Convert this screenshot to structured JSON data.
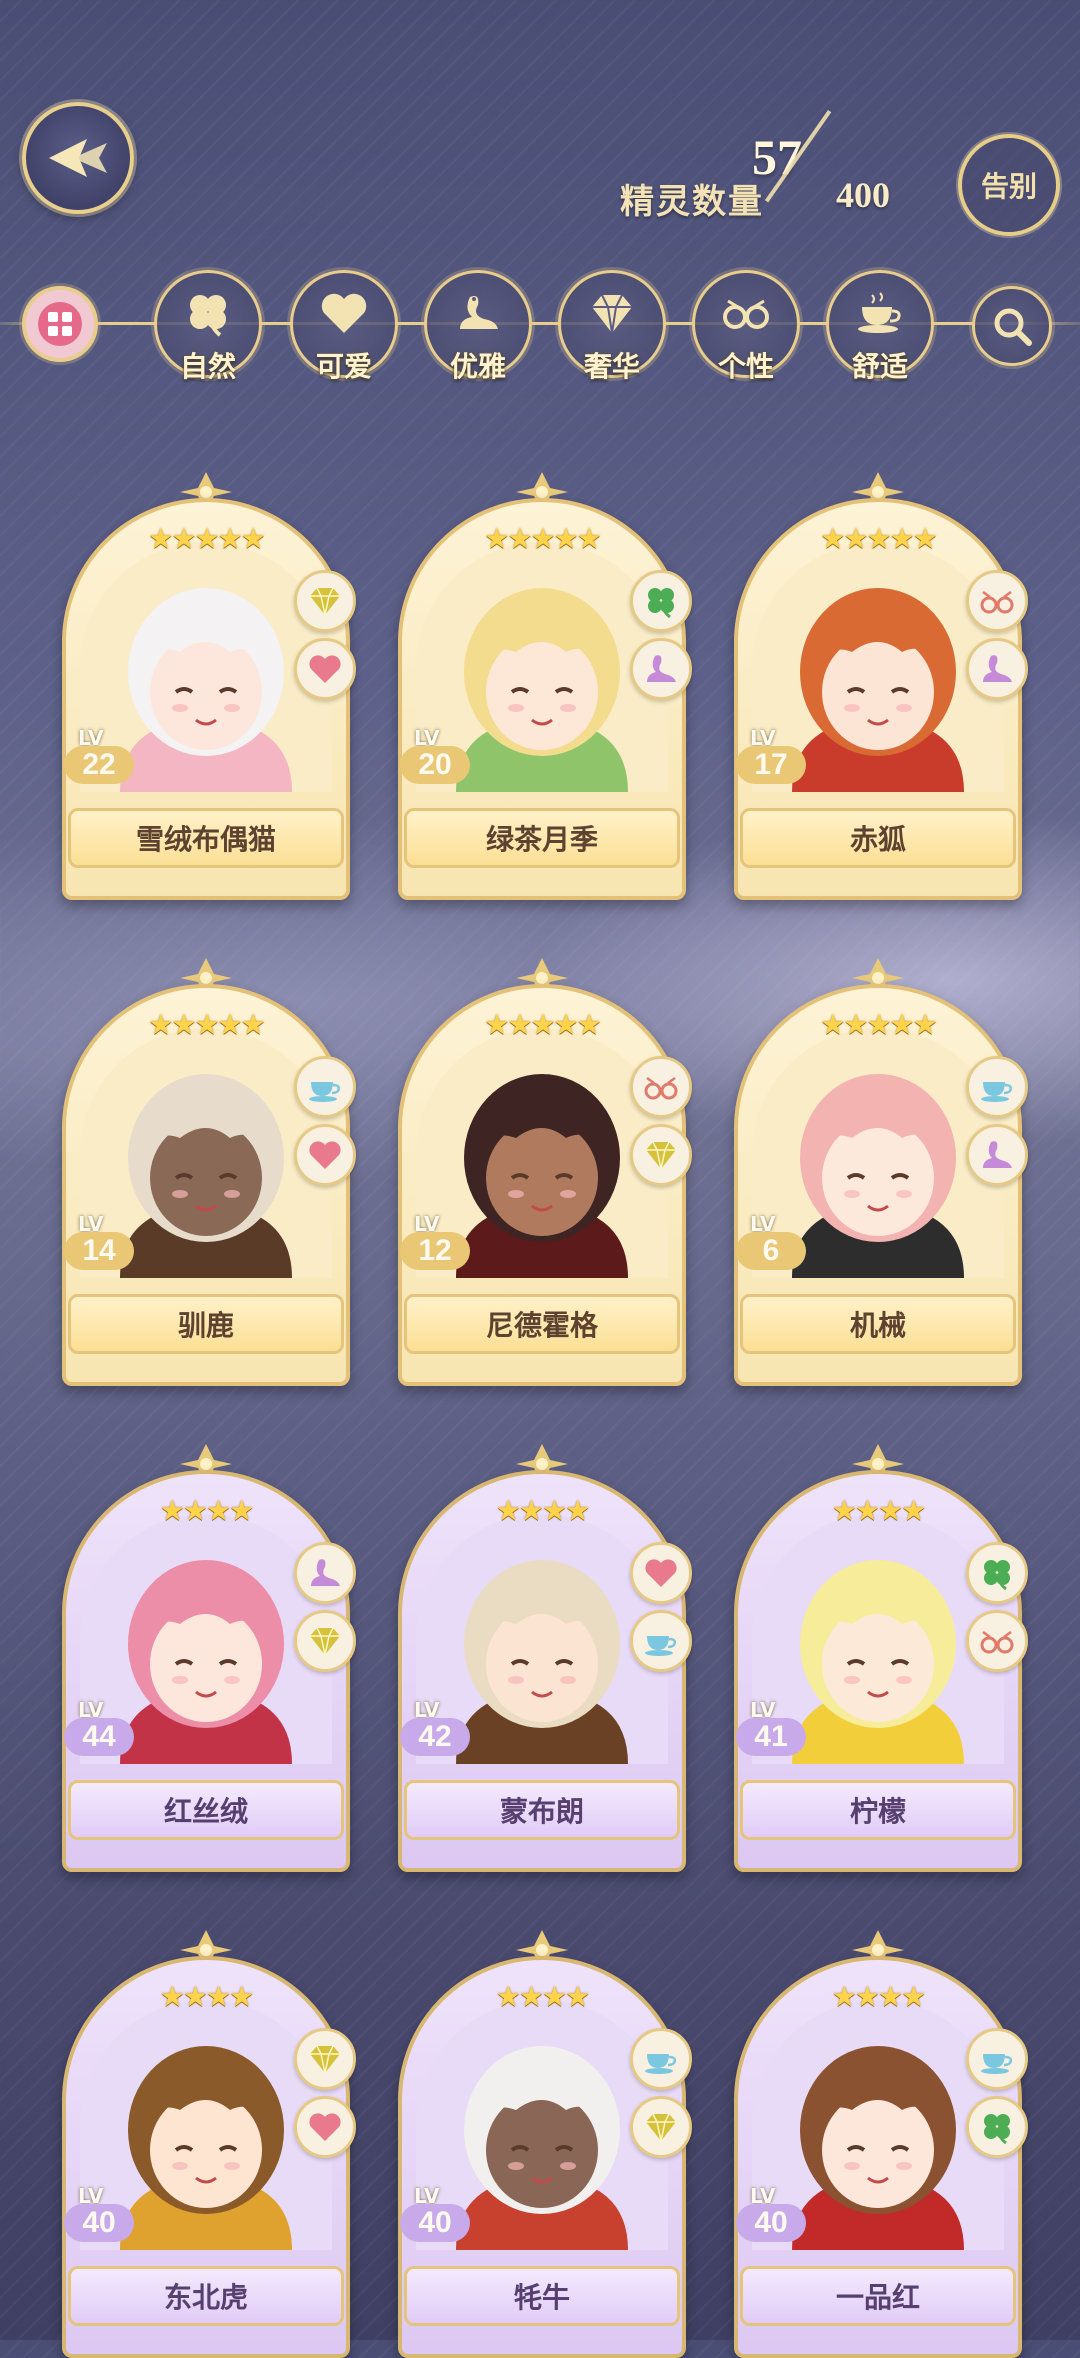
{
  "header": {
    "count_label": "精灵数量",
    "count_current": "57",
    "count_total": "400",
    "farewell_label": "告别"
  },
  "filters": [
    {
      "label": "",
      "icon": "grid-icon"
    },
    {
      "label": "自然",
      "icon": "clover-icon"
    },
    {
      "label": "可爱",
      "icon": "heart-icon"
    },
    {
      "label": "优雅",
      "icon": "swan-icon"
    },
    {
      "label": "奢华",
      "icon": "diamond-icon"
    },
    {
      "label": "个性",
      "icon": "glasses-icon"
    },
    {
      "label": "舒适",
      "icon": "teacup-icon"
    },
    {
      "label": "",
      "icon": "search-icon"
    }
  ],
  "cards": [
    {
      "name": "雪绒布偶猫",
      "level": "22",
      "stars": "★★★★★",
      "tier": "gold",
      "attrs": [
        "diamond-icon",
        "heart-icon"
      ],
      "palette": {
        "hair": "#f4f2f2",
        "skin": "#fde6dc",
        "accent": "#f3b6c2"
      }
    },
    {
      "name": "绿茶月季",
      "level": "20",
      "stars": "★★★★★",
      "tier": "gold",
      "attrs": [
        "clover-icon",
        "swan-icon"
      ],
      "palette": {
        "hair": "#f3dc8e",
        "skin": "#fde7d6",
        "accent": "#8fc46a"
      }
    },
    {
      "name": "赤狐",
      "level": "17",
      "stars": "★★★★★",
      "tier": "gold",
      "attrs": [
        "glasses-icon",
        "swan-icon"
      ],
      "palette": {
        "hair": "#d96a34",
        "skin": "#fde5d6",
        "accent": "#c93c2c"
      }
    },
    {
      "name": "驯鹿",
      "level": "14",
      "stars": "★★★★★",
      "tier": "gold",
      "attrs": [
        "teacup-icon",
        "heart-icon"
      ],
      "palette": {
        "hair": "#e7dccb",
        "skin": "#8a6a56",
        "accent": "#5a3b28"
      }
    },
    {
      "name": "尼德霍格",
      "level": "12",
      "stars": "★★★★★",
      "tier": "gold",
      "attrs": [
        "glasses-icon",
        "diamond-icon"
      ],
      "palette": {
        "hair": "#3f2424",
        "skin": "#b07a5e",
        "accent": "#5d1a1a"
      }
    },
    {
      "name": "机械",
      "level": "6",
      "stars": "★★★★★",
      "tier": "gold",
      "attrs": [
        "teacup-icon",
        "swan-icon"
      ],
      "palette": {
        "hair": "#f3b3b0",
        "skin": "#fde8dc",
        "accent": "#2d2d2d"
      }
    },
    {
      "name": "红丝绒",
      "level": "44",
      "stars": "★★★★",
      "tier": "purple",
      "attrs": [
        "swan-icon",
        "diamond-icon"
      ],
      "palette": {
        "hair": "#ec8ea7",
        "skin": "#fde6dc",
        "accent": "#c23348"
      }
    },
    {
      "name": "蒙布朗",
      "level": "42",
      "stars": "★★★★",
      "tier": "purple",
      "attrs": [
        "heart-icon",
        "teacup-icon"
      ],
      "palette": {
        "hair": "#eadcc2",
        "skin": "#fbe4d2",
        "accent": "#6b4125"
      }
    },
    {
      "name": "柠檬",
      "level": "41",
      "stars": "★★★★",
      "tier": "purple",
      "attrs": [
        "clover-icon",
        "glasses-icon"
      ],
      "palette": {
        "hair": "#f6ec9a",
        "skin": "#fde9d8",
        "accent": "#f2cf3a"
      }
    },
    {
      "name": "东北虎",
      "level": "40",
      "stars": "★★★★",
      "tier": "purple",
      "attrs": [
        "diamond-icon",
        "heart-icon"
      ],
      "palette": {
        "hair": "#8a5a2a",
        "skin": "#fde5d2",
        "accent": "#e0a22e"
      }
    },
    {
      "name": "牦牛",
      "level": "40",
      "stars": "★★★★",
      "tier": "purple",
      "attrs": [
        "teacup-icon",
        "diamond-icon"
      ],
      "palette": {
        "hair": "#f2f0ee",
        "skin": "#8a6656",
        "accent": "#c8402e"
      }
    },
    {
      "name": "一品红",
      "level": "40",
      "stars": "★★★★",
      "tier": "purple",
      "attrs": [
        "teacup-icon",
        "clover-icon"
      ],
      "palette": {
        "hair": "#8b5232",
        "skin": "#fde6da",
        "accent": "#c22a2a"
      }
    }
  ]
}
